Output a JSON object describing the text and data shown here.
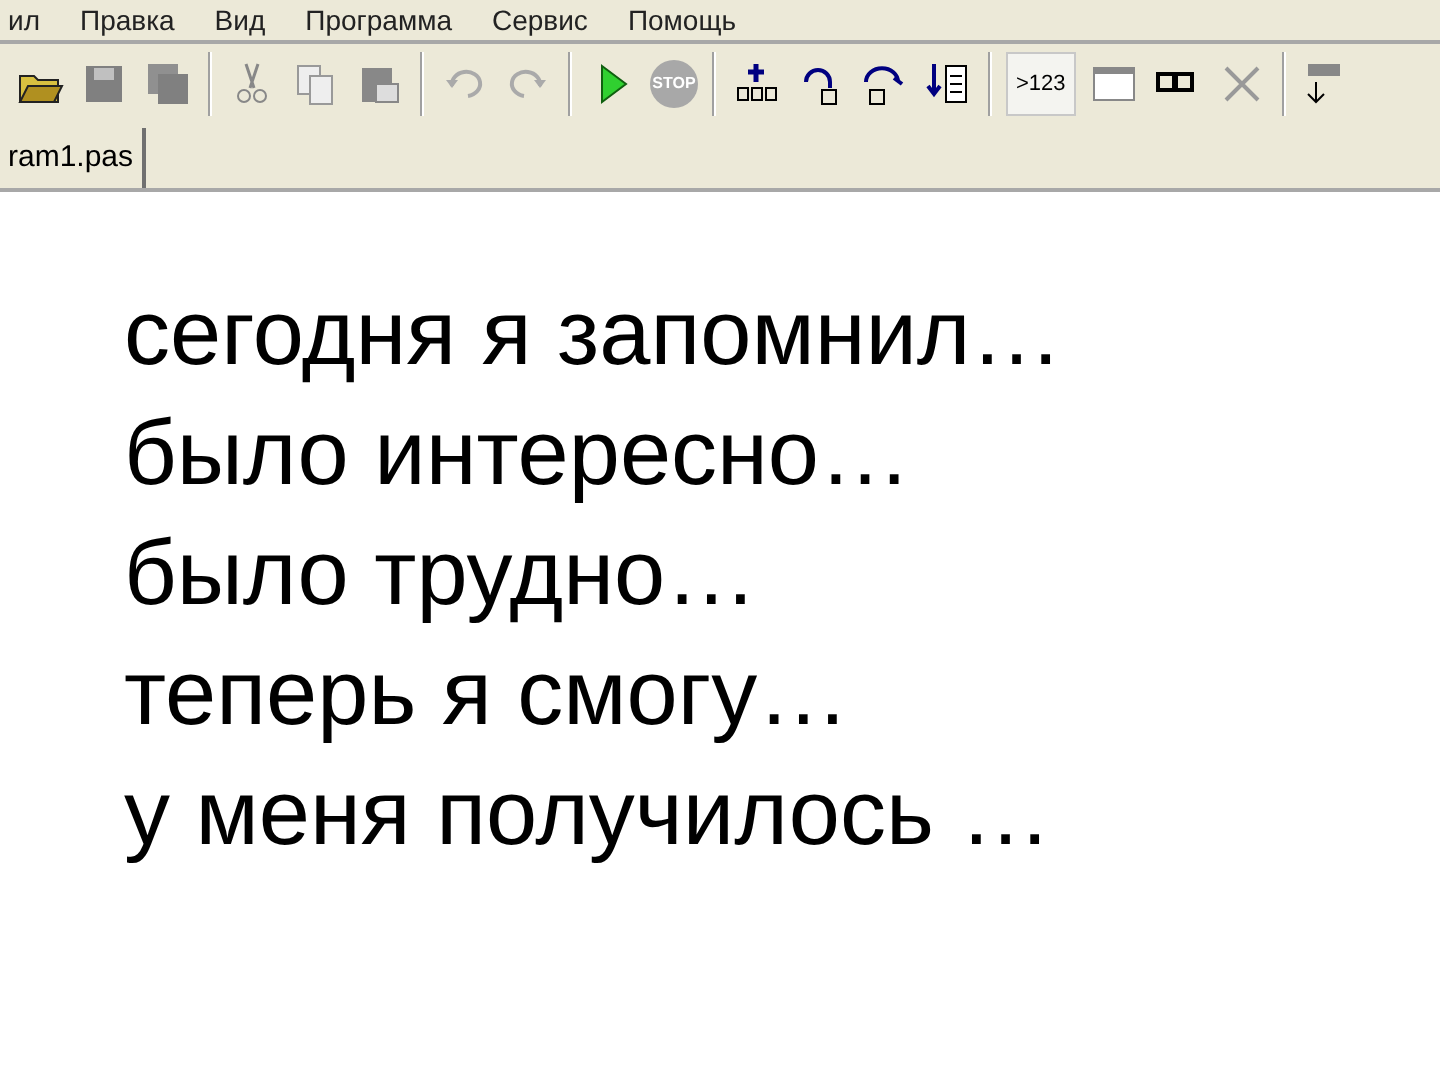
{
  "menu": [
    "ил",
    "Правка",
    "Вид",
    "Программа",
    "Сервис",
    "Помощь"
  ],
  "toolbar": {
    "stop_label": "STOP",
    "output_label": ">123"
  },
  "tabs": [
    {
      "label": "ram1.pas",
      "selected": true
    }
  ],
  "editor": {
    "lines": [
      "сегодня я запомнил…",
      "было интересно…",
      "было трудно…",
      "теперь я смогу…",
      "у меня получилось …"
    ]
  }
}
